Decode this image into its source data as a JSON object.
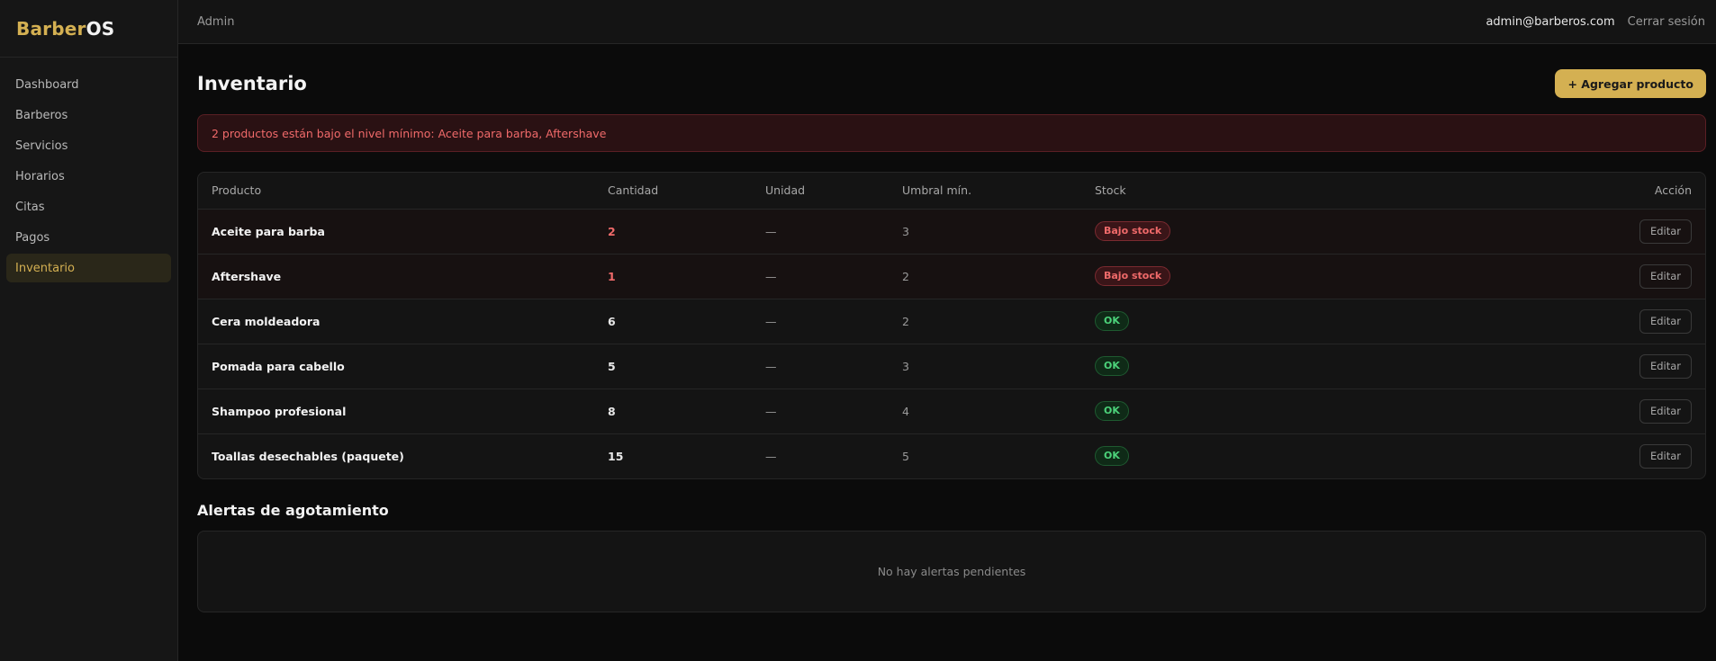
{
  "brand": {
    "part1": "Barber",
    "part2": "OS"
  },
  "sidebar": {
    "items": [
      {
        "label": "Dashboard",
        "active": false
      },
      {
        "label": "Barberos",
        "active": false
      },
      {
        "label": "Servicios",
        "active": false
      },
      {
        "label": "Horarios",
        "active": false
      },
      {
        "label": "Citas",
        "active": false
      },
      {
        "label": "Pagos",
        "active": false
      },
      {
        "label": "Inventario",
        "active": true
      }
    ]
  },
  "topbar": {
    "breadcrumb": "Admin",
    "email": "admin@barberos.com",
    "logout": "Cerrar sesión"
  },
  "page": {
    "title": "Inventario",
    "add_button": "+ Agregar producto",
    "alert": "2 productos están bajo el nivel mínimo: Aceite para barba, Aftershave"
  },
  "table": {
    "headers": [
      "Producto",
      "Cantidad",
      "Unidad",
      "Umbral mín.",
      "Stock",
      "Acción"
    ],
    "rows": [
      {
        "product": "Aceite para barba",
        "qty": "2",
        "unit": "—",
        "min": "3",
        "status": "Bajo stock",
        "low": true,
        "action": "Editar"
      },
      {
        "product": "Aftershave",
        "qty": "1",
        "unit": "—",
        "min": "2",
        "status": "Bajo stock",
        "low": true,
        "action": "Editar"
      },
      {
        "product": "Cera moldeadora",
        "qty": "6",
        "unit": "—",
        "min": "2",
        "status": "OK",
        "low": false,
        "action": "Editar"
      },
      {
        "product": "Pomada para cabello",
        "qty": "5",
        "unit": "—",
        "min": "3",
        "status": "OK",
        "low": false,
        "action": "Editar"
      },
      {
        "product": "Shampoo profesional",
        "qty": "8",
        "unit": "—",
        "min": "4",
        "status": "OK",
        "low": false,
        "action": "Editar"
      },
      {
        "product": "Toallas desechables (paquete)",
        "qty": "15",
        "unit": "—",
        "min": "5",
        "status": "OK",
        "low": false,
        "action": "Editar"
      }
    ]
  },
  "alerts_section": {
    "title": "Alertas de agotamiento",
    "empty_text": "No hay alertas pendientes"
  },
  "colors": {
    "accent": "#d4b052",
    "danger": "#f06a6a",
    "success": "#4cd27a",
    "background": "#0b0b0b"
  }
}
